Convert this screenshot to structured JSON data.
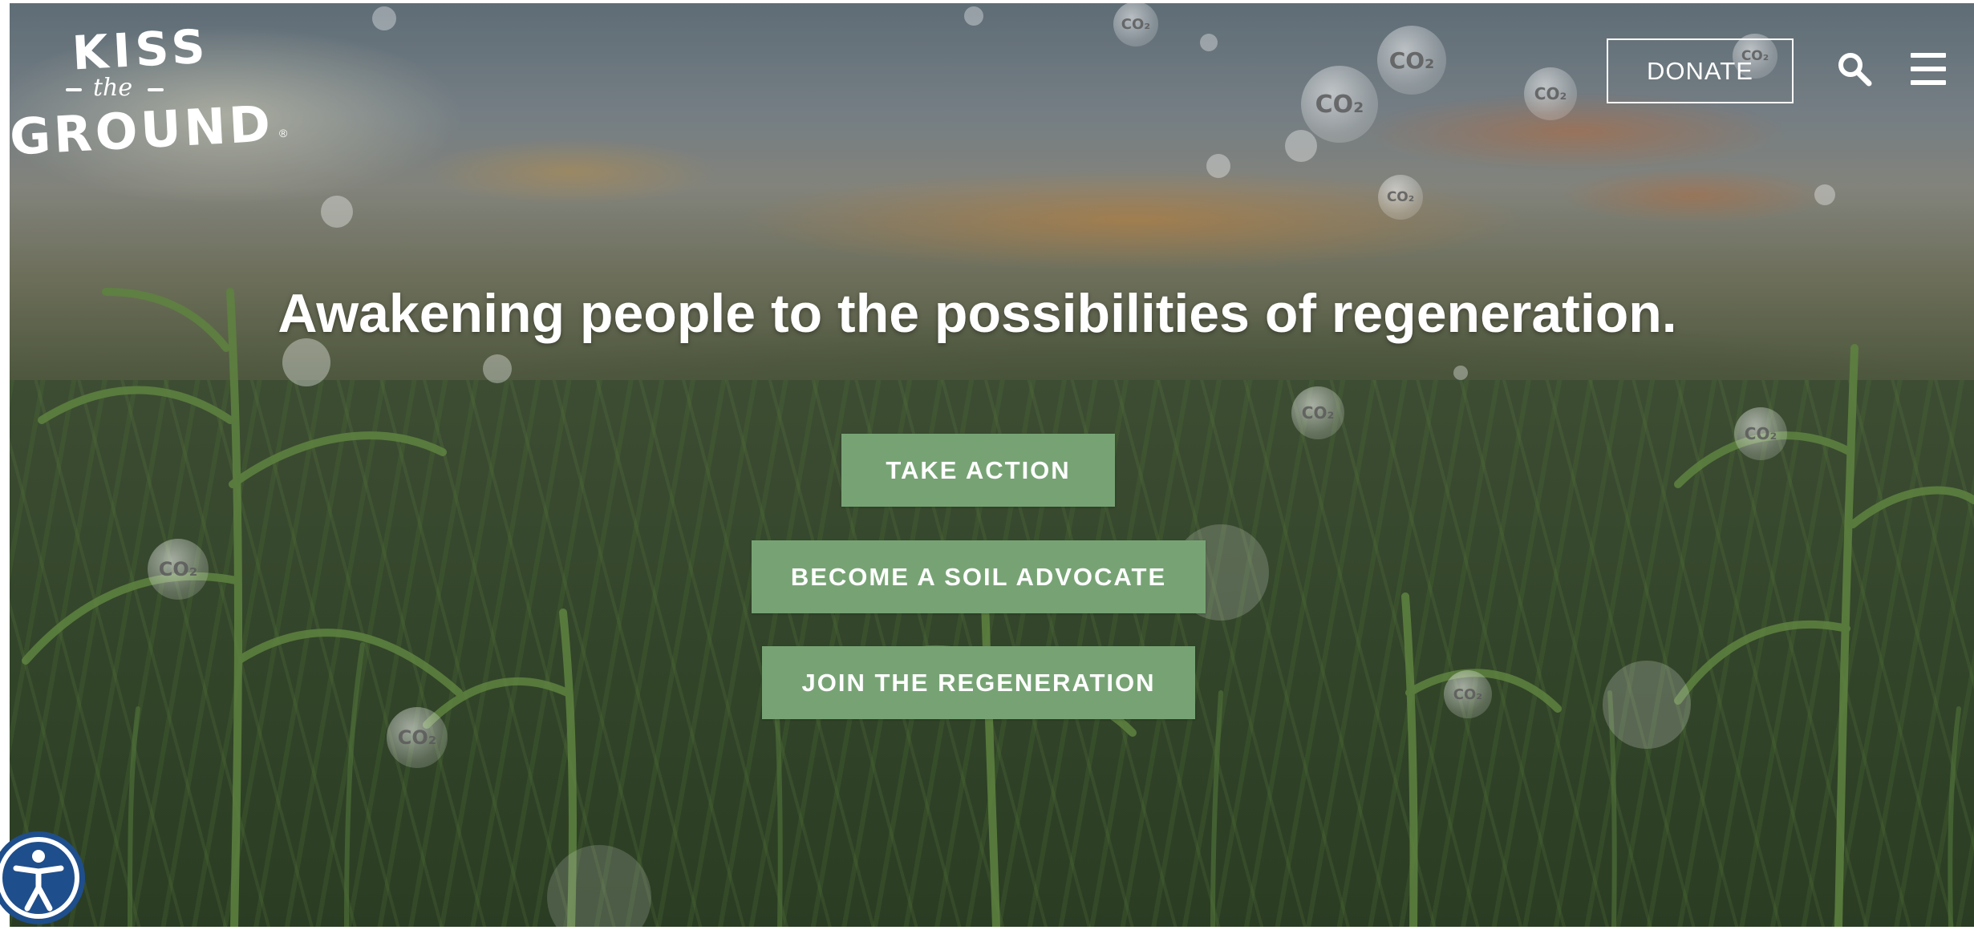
{
  "brand": {
    "logo_kiss": "KISS",
    "logo_the": "the",
    "logo_ground": "GROUND",
    "logo_registered": "®"
  },
  "header": {
    "donate_label": "DONATE",
    "search_icon": "search-icon",
    "menu_icon": "hamburger-menu-icon"
  },
  "hero": {
    "headline": "Awakening people to the possibilities of regeneration.",
    "co2_label": "CO₂",
    "buttons": [
      {
        "label": "TAKE ACTION"
      },
      {
        "label": "BECOME A SOIL ADVOCATE"
      },
      {
        "label": "JOIN THE REGENERATION"
      }
    ]
  },
  "accessibility": {
    "icon": "accessibility-icon"
  },
  "colors": {
    "button_green": "#77a374",
    "text_white": "#ffffff",
    "a11y_blue": "#1f4e8c"
  }
}
